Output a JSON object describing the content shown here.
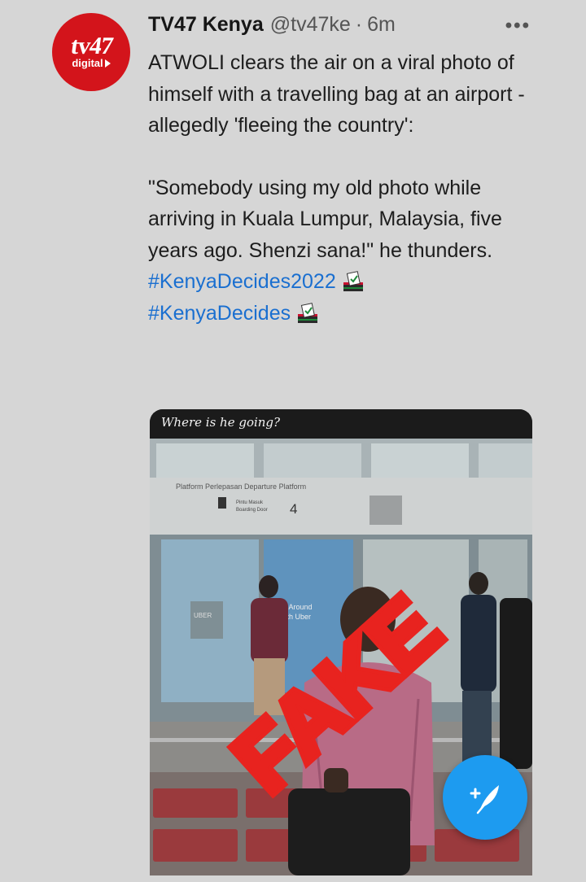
{
  "tweet": {
    "author_name": "TV47 Kenya",
    "author_handle": "@tv47ke",
    "separator": "·",
    "time_ago": "6m",
    "more_label": "•••",
    "avatar": {
      "logo_text": "tv47",
      "logo_sub": "digital"
    },
    "paragraph1": "ATWOLI clears the air on a viral photo of himself with a travelling bag at an airport -allegedly 'fleeing the country':",
    "paragraph2": "\"Somebody using my old photo while arriving in Kuala Lumpur, Malaysia, five years ago. Shenzi sana!\" he thunders.",
    "hashtags": [
      "#KenyaDecides2022",
      "#KenyaDecides"
    ],
    "hashtag_icon": "ballot-box-icon"
  },
  "media": {
    "caption": "Where is he going?",
    "stamp_text": "FAKE",
    "signs": {
      "platform": "Platform Perlepasan  Departure Platform",
      "door_ms": "Pintu Masuk",
      "door_en": "Boarding Door",
      "door_number": "4",
      "uber_sign": "UBER",
      "uber_line1": "Get Around",
      "uber_line2": "with Uber"
    }
  },
  "compose_button": {
    "icon": "compose-plus-feather-icon"
  },
  "colors": {
    "link": "#1a6fd0",
    "fab": "#1d9bf0",
    "stamp": "#e8231f",
    "avatar_bg": "#d3141b"
  }
}
